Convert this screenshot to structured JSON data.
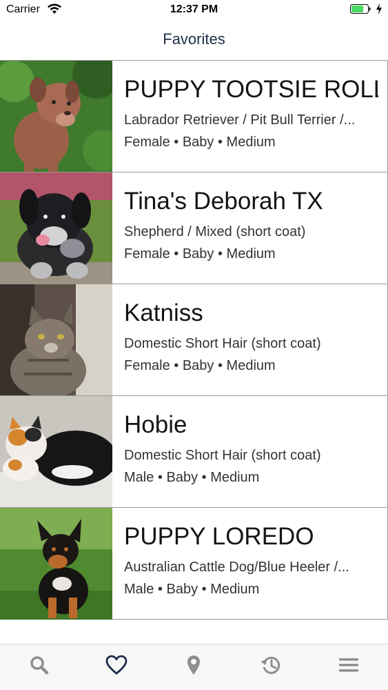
{
  "status_bar": {
    "carrier": "Carrier",
    "time": "12:37 PM"
  },
  "nav": {
    "title": "Favorites"
  },
  "pets": [
    {
      "name": "PUPPY TOOTSIE ROLL",
      "breed": "Labrador Retriever / Pit Bull Terrier /...",
      "sex": "Female",
      "age": "Baby",
      "size": "Medium",
      "photo_icon": "dog-photo"
    },
    {
      "name": "Tina's Deborah TX",
      "breed": "Shepherd / Mixed (short coat)",
      "sex": "Female",
      "age": "Baby",
      "size": "Medium",
      "photo_icon": "dog-photo"
    },
    {
      "name": "Katniss",
      "breed": "Domestic Short Hair (short coat)",
      "sex": "Female",
      "age": "Baby",
      "size": "Medium",
      "photo_icon": "cat-photo"
    },
    {
      "name": "Hobie",
      "breed": "Domestic Short Hair (short coat)",
      "sex": "Male",
      "age": "Baby",
      "size": "Medium",
      "photo_icon": "cat-photo"
    },
    {
      "name": "PUPPY LOREDO",
      "breed": "Australian Cattle Dog/Blue Heeler /...",
      "sex": "Male",
      "age": "Baby",
      "size": "Medium",
      "photo_icon": "dog-photo"
    }
  ],
  "separator": " • ",
  "tab_bar": {
    "tabs": [
      {
        "icon": "search-icon",
        "selected": false
      },
      {
        "icon": "heart-icon",
        "selected": true
      },
      {
        "icon": "location-pin-icon",
        "selected": false
      },
      {
        "icon": "history-icon",
        "selected": false
      },
      {
        "icon": "menu-icon",
        "selected": false
      }
    ]
  },
  "colors": {
    "tab_active": "#1f2d4a",
    "tab_inactive": "#8e8e8e",
    "divider": "#9a9a9a",
    "battery_green": "#4cd964"
  }
}
